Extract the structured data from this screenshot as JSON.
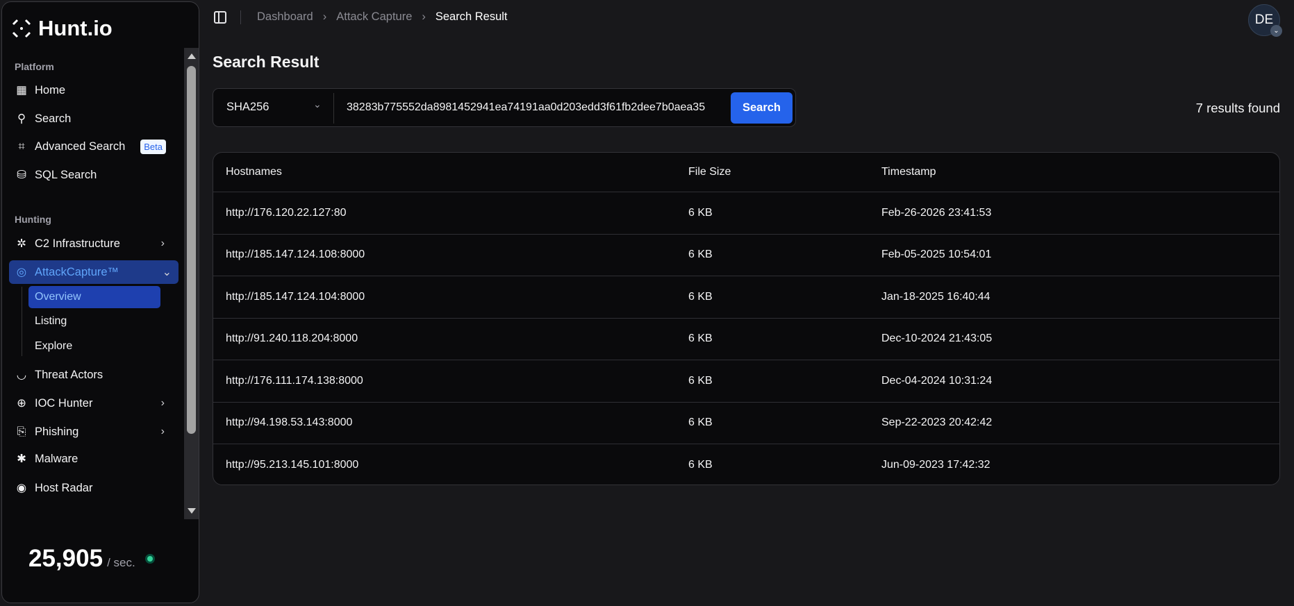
{
  "logo": {
    "text": "Hunt.io"
  },
  "sidebar": {
    "platform_label": "Platform",
    "hunting_label": "Hunting",
    "items": {
      "home": "Home",
      "search": "Search",
      "advanced": "Advanced Search",
      "advanced_badge": "Beta",
      "sql": "SQL Search",
      "c2": "C2 Infrastructure",
      "attack": "AttackCapture™",
      "overview": "Overview",
      "listing": "Listing",
      "explore": "Explore",
      "threat": "Threat Actors",
      "ioc": "IOC Hunter",
      "phishing": "Phishing",
      "malware": "Malware",
      "radar": "Host Radar"
    },
    "rate": {
      "value": "25,905",
      "unit": "/ sec."
    }
  },
  "header": {
    "breadcrumb": [
      "Dashboard",
      "Attack Capture",
      "Search Result"
    ],
    "avatar": "DE"
  },
  "main": {
    "title": "Search Result",
    "search": {
      "type": "SHA256",
      "value": "38283b775552da8981452941ea74191aa0d203edd3f61fb2dee7b0aea35",
      "button": "Search"
    },
    "results_count": "7 results found",
    "table": {
      "headers": [
        "Hostnames",
        "File Size",
        "Timestamp"
      ],
      "rows": [
        [
          "http://176.120.22.127:80",
          "6 KB",
          "Feb-26-2026 23:41:53"
        ],
        [
          "http://185.147.124.108:8000",
          "6 KB",
          "Feb-05-2025 10:54:01"
        ],
        [
          "http://185.147.124.104:8000",
          "6 KB",
          "Jan-18-2025 16:40:44"
        ],
        [
          "http://91.240.118.204:8000",
          "6 KB",
          "Dec-10-2024 21:43:05"
        ],
        [
          "http://176.111.174.138:8000",
          "6 KB",
          "Dec-04-2024 10:31:24"
        ],
        [
          "http://94.198.53.143:8000",
          "6 KB",
          "Sep-22-2023 20:42:42"
        ],
        [
          "http://95.213.145.101:8000",
          "6 KB",
          "Jun-09-2023 17:42:32"
        ]
      ]
    }
  },
  "colors": {
    "accent": "#2563eb",
    "active_bg": "#1e3a8a",
    "status": "#34d399"
  }
}
